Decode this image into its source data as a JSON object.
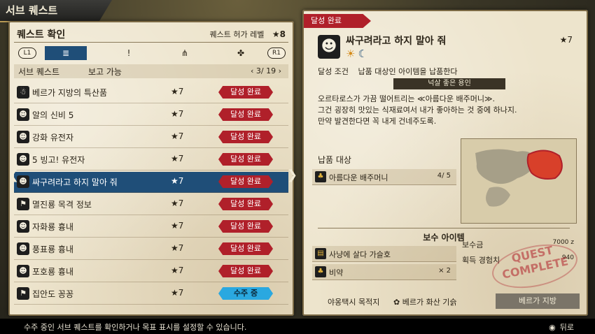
{
  "window": {
    "title": "서브 퀘스트"
  },
  "list_header": {
    "title": "퀘스트 확인",
    "level_label": "퀘스트 허가 레벨",
    "level_value": "★8"
  },
  "tabs": {
    "left_btn": "L1",
    "right_btn": "R1",
    "items": [
      {
        "icon": "≣"
      },
      {
        "icon": "!"
      },
      {
        "icon": "⋔"
      },
      {
        "icon": "✤"
      }
    ]
  },
  "filter": {
    "category": "서브 퀘스트",
    "report": "보고 가능",
    "page": "3/ 19"
  },
  "quests": [
    {
      "icon": "☃",
      "name": "베르가 지방의 특산품",
      "stars": "★7",
      "status": "달성 완료",
      "kind": "done"
    },
    {
      "icon": "☻",
      "name": "알의 신비 5",
      "stars": "★7",
      "status": "달성 완료",
      "kind": "done"
    },
    {
      "icon": "☻",
      "name": "강화 유전자",
      "stars": "★7",
      "status": "달성 완료",
      "kind": "done"
    },
    {
      "icon": "☻",
      "name": "5 빙고! 유전자",
      "stars": "★7",
      "status": "달성 완료",
      "kind": "done"
    },
    {
      "icon": "☻",
      "name": "싸구려라고 하지 말아 줘",
      "stars": "★7",
      "status": "달성 완료",
      "kind": "done"
    },
    {
      "icon": "⚑",
      "name": "멸진룡 목격 정보",
      "stars": "★7",
      "status": "달성 완료",
      "kind": "done"
    },
    {
      "icon": "☻",
      "name": "자화룡 흉내",
      "stars": "★7",
      "status": "달성 완료",
      "kind": "done"
    },
    {
      "icon": "☻",
      "name": "풍표룡 흉내",
      "stars": "★7",
      "status": "달성 완료",
      "kind": "done"
    },
    {
      "icon": "☻",
      "name": "포호룡 흉내",
      "stars": "★7",
      "status": "달성 완료",
      "kind": "done"
    },
    {
      "icon": "⚑",
      "name": "집안도 꽁꽁",
      "stars": "★7",
      "status": "수주 중",
      "kind": "active"
    }
  ],
  "detail": {
    "tag": "달성 완료",
    "title": "싸구려라고 하지 말아 줘",
    "stars": "★7",
    "condition_label": "달성 조건",
    "condition": "납품 대상인 아이템을 납품한다",
    "client": "넉살 좋은 용인",
    "description": [
      "오르타로스가 가끔 떨어트리는 ≪아름다운 배주머니≫.",
      "그건 굉장히 맛있는 식재료여서 내가 좋아하는 것 중에 하나지.",
      "만약 발견한다면 꼭 내게 건네주도록."
    ],
    "delivery_label": "납품 대상",
    "delivery_item": "아름다운 배주머니",
    "delivery_count": "4/   5",
    "reward_label": "보수 아이템",
    "rewards": [
      {
        "name": "사냥에 살다 가슬호",
        "qty": ""
      },
      {
        "name": "비약",
        "qty": "×   2"
      }
    ],
    "money_label": "보수금",
    "money": "7000 z",
    "exp_label": "획득 경험치",
    "exp": "940",
    "stamp": "QUEST COMPLETE",
    "taxi_label": "야옹택시 목적지",
    "taxi_dest": "베르가 화산 기슭",
    "region_button": "베르가 지방"
  },
  "footer": {
    "message": "수주 중인 서브 퀘스트를 확인하거나 목표 표시를 설정할 수 있습니다.",
    "back": "뒤로"
  },
  "colors": {
    "selected": "#1f4e78",
    "done": "#b0202a",
    "active": "#2aa8e0",
    "parchment": "#ede4cc"
  }
}
